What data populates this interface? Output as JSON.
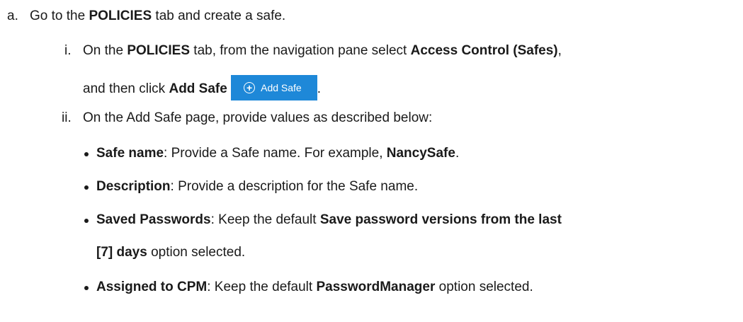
{
  "step_a": {
    "marker": "a.",
    "p1": "Go to the ",
    "b1": "POLICIES",
    "p2": " tab and create a safe."
  },
  "step_i": {
    "marker": "i.",
    "p1": "On the ",
    "b1": "POLICIES",
    "p2": " tab, from the navigation pane select ",
    "b2": "Access Control (Safes)",
    "p3": ",",
    "p4": "and then click ",
    "b3": "Add Safe",
    "p5": " ",
    "p6": ".",
    "button": {
      "label": "Add Safe",
      "icon": "plus-circle-icon",
      "color": "#1e88d8"
    }
  },
  "step_ii": {
    "marker": "ii.",
    "text": "On the Add Safe page, provide values as described below:"
  },
  "bullets": [
    {
      "b1": "Safe name",
      "p1": ": Provide a Safe name. For example, ",
      "b2": "NancySafe",
      "p2": "."
    },
    {
      "b1": "Description",
      "p1": ": Provide a description for the Safe name."
    },
    {
      "b1": "Saved Passwords",
      "p1": ": Keep the default ",
      "b2": "Save password versions from the last",
      "b3": "[7] days",
      "p2": " option selected."
    },
    {
      "b1": "Assigned to CPM",
      "p1": ": Keep the default ",
      "b2": "PasswordManager",
      "p2": " option selected."
    }
  ]
}
